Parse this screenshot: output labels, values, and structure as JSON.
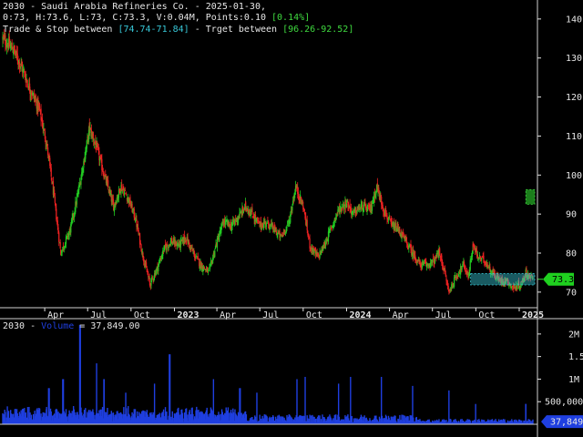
{
  "header": {
    "line1_prefix": "2030 - Saudi Arabia Refineries Co. - 2025-01-30,",
    "line2_prefix": "0:73, H:73.6, L:73, C:73.3, V:0.04M, Points:0.10 ",
    "line2_change": "[0.14%]",
    "line3_a": "Trade & Stop between ",
    "line3_b": "[74.74-71.84]",
    "line3_c": " - Trget between ",
    "line3_d": "[96.26-92.52]"
  },
  "volume_header": {
    "symbol": "2030 - ",
    "label": "Volume",
    "value": " = 37,849.00"
  },
  "colors": {
    "background": "#000000",
    "up": "#22cc22",
    "down": "#ee2222",
    "volume": "#1f3fe0",
    "trade_zone": "#38c8d8",
    "target_zone": "#1e8c1e",
    "axis_text": "#e6e6e6"
  },
  "chart_data": [
    {
      "type": "candlestick",
      "y_ticks": [
        "140",
        "130",
        "120",
        "110",
        "100",
        "90",
        "80",
        "70"
      ],
      "ylim": [
        66,
        143
      ],
      "x_ticks": [
        "Apr",
        "Jul",
        "Oct",
        "2023",
        "Apr",
        "Jul",
        "Oct",
        "2024",
        "Apr",
        "Jul",
        "Oct",
        "2025"
      ],
      "x_tick_dates": [
        "2022-04-01",
        "2022-07-01",
        "2022-10-01",
        "2023-01-01",
        "2023-04-01",
        "2023-07-01",
        "2023-10-01",
        "2024-01-01",
        "2024-04-01",
        "2024-07-01",
        "2024-10-01",
        "2025-01-01"
      ],
      "date_range": [
        "2022-01-02",
        "2025-01-30"
      ],
      "close_path": [
        {
          "date": "2022-01-02",
          "close": 135
        },
        {
          "date": "2022-01-25",
          "close": 132
        },
        {
          "date": "2022-02-10",
          "close": 128
        },
        {
          "date": "2022-03-01",
          "close": 122
        },
        {
          "date": "2022-03-20",
          "close": 117
        },
        {
          "date": "2022-04-05",
          "close": 108
        },
        {
          "date": "2022-04-20",
          "close": 95
        },
        {
          "date": "2022-05-05",
          "close": 80
        },
        {
          "date": "2022-05-25",
          "close": 86
        },
        {
          "date": "2022-06-10",
          "close": 95
        },
        {
          "date": "2022-06-25",
          "close": 105
        },
        {
          "date": "2022-07-05",
          "close": 112
        },
        {
          "date": "2022-07-20",
          "close": 107
        },
        {
          "date": "2022-08-05",
          "close": 100
        },
        {
          "date": "2022-08-25",
          "close": 92
        },
        {
          "date": "2022-09-10",
          "close": 97
        },
        {
          "date": "2022-09-25",
          "close": 94
        },
        {
          "date": "2022-10-10",
          "close": 89
        },
        {
          "date": "2022-10-25",
          "close": 80
        },
        {
          "date": "2022-11-10",
          "close": 72
        },
        {
          "date": "2022-11-25",
          "close": 76
        },
        {
          "date": "2022-12-10",
          "close": 81
        },
        {
          "date": "2022-12-25",
          "close": 83
        },
        {
          "date": "2023-01-10",
          "close": 82
        },
        {
          "date": "2023-01-25",
          "close": 84
        },
        {
          "date": "2023-02-10",
          "close": 80
        },
        {
          "date": "2023-02-25",
          "close": 77
        },
        {
          "date": "2023-03-15",
          "close": 75
        },
        {
          "date": "2023-03-30",
          "close": 82
        },
        {
          "date": "2023-04-15",
          "close": 88
        },
        {
          "date": "2023-05-01",
          "close": 87
        },
        {
          "date": "2023-05-15",
          "close": 89
        },
        {
          "date": "2023-06-01",
          "close": 92
        },
        {
          "date": "2023-06-15",
          "close": 90
        },
        {
          "date": "2023-07-01",
          "close": 87
        },
        {
          "date": "2023-07-15",
          "close": 88
        },
        {
          "date": "2023-08-01",
          "close": 86
        },
        {
          "date": "2023-08-15",
          "close": 84
        },
        {
          "date": "2023-09-01",
          "close": 88
        },
        {
          "date": "2023-09-15",
          "close": 97
        },
        {
          "date": "2023-10-01",
          "close": 92
        },
        {
          "date": "2023-10-15",
          "close": 82
        },
        {
          "date": "2023-11-01",
          "close": 79
        },
        {
          "date": "2023-11-15",
          "close": 82
        },
        {
          "date": "2023-12-01",
          "close": 87
        },
        {
          "date": "2023-12-15",
          "close": 91
        },
        {
          "date": "2024-01-01",
          "close": 93
        },
        {
          "date": "2024-01-15",
          "close": 90
        },
        {
          "date": "2024-02-01",
          "close": 92
        },
        {
          "date": "2024-02-20",
          "close": 91
        },
        {
          "date": "2024-03-05",
          "close": 97
        },
        {
          "date": "2024-03-20",
          "close": 91
        },
        {
          "date": "2024-04-05",
          "close": 87
        },
        {
          "date": "2024-04-20",
          "close": 86
        },
        {
          "date": "2024-05-05",
          "close": 83
        },
        {
          "date": "2024-05-20",
          "close": 80
        },
        {
          "date": "2024-06-05",
          "close": 77
        },
        {
          "date": "2024-06-20",
          "close": 77
        },
        {
          "date": "2024-07-05",
          "close": 78
        },
        {
          "date": "2024-07-15",
          "close": 80
        },
        {
          "date": "2024-07-25",
          "close": 76
        },
        {
          "date": "2024-08-05",
          "close": 70
        },
        {
          "date": "2024-08-20",
          "close": 74
        },
        {
          "date": "2024-09-05",
          "close": 77
        },
        {
          "date": "2024-09-15",
          "close": 74
        },
        {
          "date": "2024-09-25",
          "close": 82
        },
        {
          "date": "2024-10-05",
          "close": 79
        },
        {
          "date": "2024-10-20",
          "close": 78
        },
        {
          "date": "2024-11-05",
          "close": 75
        },
        {
          "date": "2024-11-20",
          "close": 73
        },
        {
          "date": "2024-12-05",
          "close": 73
        },
        {
          "date": "2024-12-20",
          "close": 71
        },
        {
          "date": "2025-01-05",
          "close": 72
        },
        {
          "date": "2025-01-15",
          "close": 75
        },
        {
          "date": "2025-01-30",
          "close": 73.3
        }
      ],
      "last_price": "73.3",
      "last_bar": {
        "open": 73,
        "high": 73.6,
        "low": 73,
        "close": 73.3,
        "volume_m": 0.04
      },
      "zones": [
        {
          "name": "trade-stop",
          "start": "2024-09-20",
          "end": "2025-01-30",
          "low": 71.84,
          "high": 74.74
        },
        {
          "name": "target",
          "start": "2025-01-15",
          "end": "2025-01-30",
          "low": 92.52,
          "high": 96.26
        }
      ]
    },
    {
      "type": "bar",
      "series": [
        {
          "name": "Volume",
          "values_desc": "daily volume"
        }
      ],
      "y_ticks": [
        {
          "value": 2000000,
          "label": "2M"
        },
        {
          "value": 1500000,
          "label": "1.5M"
        },
        {
          "value": 1000000,
          "label": "1M"
        },
        {
          "value": 500000,
          "label": "500,000"
        }
      ],
      "ylim": [
        0,
        2300000
      ],
      "last_value": 37849,
      "last_label": "37,849",
      "spikes": [
        {
          "date": "2022-04-10",
          "volume": 800000
        },
        {
          "date": "2022-05-10",
          "volume": 1000000
        },
        {
          "date": "2022-06-15",
          "volume": 2200000
        },
        {
          "date": "2022-07-20",
          "volume": 1350000
        },
        {
          "date": "2022-08-05",
          "volume": 1000000
        },
        {
          "date": "2022-09-20",
          "volume": 700000
        },
        {
          "date": "2022-11-20",
          "volume": 900000
        },
        {
          "date": "2022-12-22",
          "volume": 1550000
        },
        {
          "date": "2023-03-25",
          "volume": 1000000
        },
        {
          "date": "2023-05-20",
          "volume": 800000
        },
        {
          "date": "2023-06-25",
          "volume": 700000
        },
        {
          "date": "2023-09-18",
          "volume": 1000000
        },
        {
          "date": "2023-10-05",
          "volume": 1050000
        },
        {
          "date": "2023-12-15",
          "volume": 900000
        },
        {
          "date": "2024-01-10",
          "volume": 1050000
        },
        {
          "date": "2024-03-15",
          "volume": 1050000
        },
        {
          "date": "2024-05-20",
          "volume": 850000
        },
        {
          "date": "2024-08-05",
          "volume": 750000
        },
        {
          "date": "2024-10-01",
          "volume": 450000
        },
        {
          "date": "2025-01-15",
          "volume": 450000
        }
      ]
    }
  ]
}
